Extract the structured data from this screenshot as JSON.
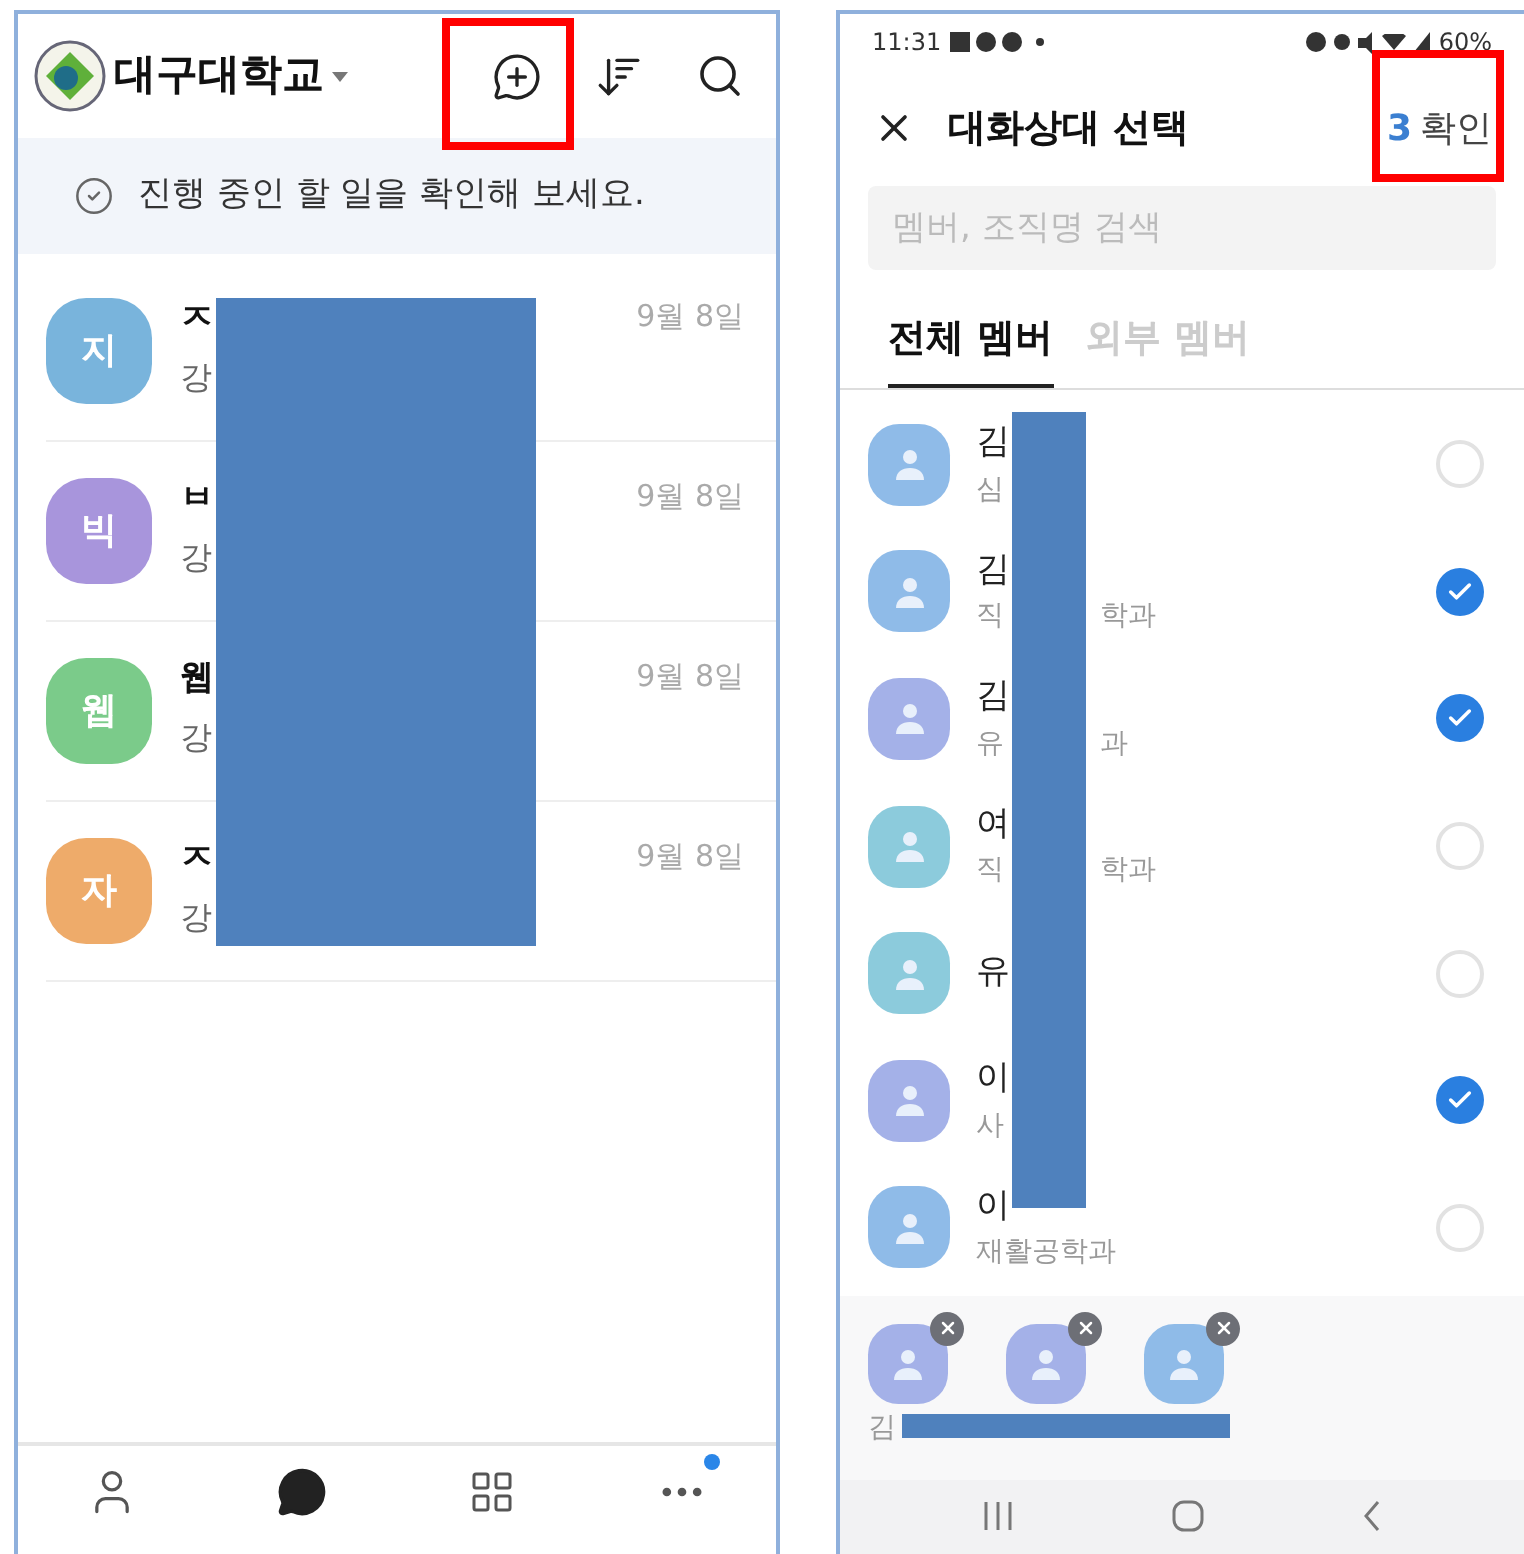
{
  "left_screen": {
    "header": {
      "org_name": "대구대학교",
      "new_chat_highlighted": true
    },
    "banner": "진행 중인 할 일을 확인해 보세요.",
    "chats": [
      {
        "avatar": "지",
        "color": "#79b4dc",
        "name": "ㅈ",
        "preview": "강",
        "date": "9월 8일"
      },
      {
        "avatar": "빅",
        "color": "#a895dc",
        "name": "ㅂ",
        "preview": "강",
        "date": "9월 8일"
      },
      {
        "avatar": "웹",
        "color": "#7bcb8a",
        "name": "웹",
        "preview": "강",
        "date": "9월 8일"
      },
      {
        "avatar": "자",
        "color": "#eeab6a",
        "name": "ㅈ",
        "preview": "강",
        "date": "9월 8일"
      }
    ],
    "bottom_nav": [
      {
        "kind": "person",
        "selected": false,
        "badge": false
      },
      {
        "kind": "chat",
        "selected": true,
        "badge": false
      },
      {
        "kind": "grid",
        "selected": false,
        "badge": false
      },
      {
        "kind": "more",
        "selected": false,
        "badge": true
      }
    ]
  },
  "right_screen": {
    "status_bar": {
      "time": "11:31",
      "battery": "60%"
    },
    "title": "대화상대 선택",
    "selected_count": "3",
    "confirm": "확인",
    "confirm_highlighted": true,
    "search_placeholder": "멤버, 조직명 검색",
    "tabs": [
      {
        "label": "전체 멤버",
        "selected": true
      },
      {
        "label": "외부 멤버",
        "selected": false
      }
    ],
    "members": [
      {
        "name": "김",
        "dept": "심",
        "color": "#8fbbe8",
        "checked": false
      },
      {
        "name": "김",
        "dept": "직",
        "dept_tail": "학과",
        "color": "#8fbbe8",
        "checked": true
      },
      {
        "name": "김",
        "dept": "유",
        "dept_tail": "과",
        "color": "#a4b1e8",
        "checked": true
      },
      {
        "name": "여",
        "dept": "직",
        "dept_tail": "학과",
        "color": "#8ccbdc",
        "checked": false
      },
      {
        "name": "유",
        "color": "#8ccbdc",
        "checked": false
      },
      {
        "name": "이",
        "dept": "사",
        "color": "#a4b1e8",
        "checked": true
      },
      {
        "name": "이",
        "dept": "재활공학과",
        "color": "#8fbbe8",
        "checked": false
      }
    ],
    "chosen": [
      {
        "name": "김",
        "color": "#a4b1e8"
      },
      {
        "color": "#a4b1e8"
      },
      {
        "color": "#8fbbe8"
      }
    ]
  }
}
